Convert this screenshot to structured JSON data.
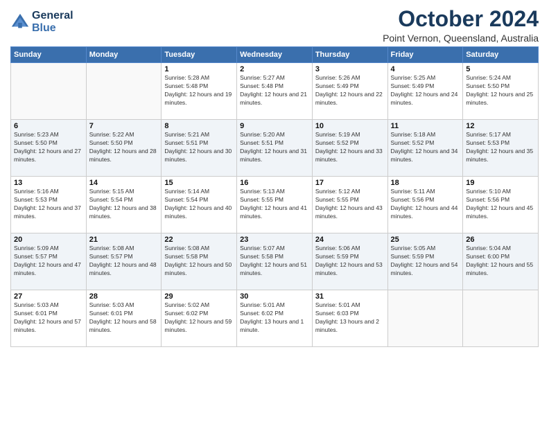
{
  "logo": {
    "line1": "General",
    "line2": "Blue"
  },
  "title": "October 2024",
  "subtitle": "Point Vernon, Queensland, Australia",
  "weekdays": [
    "Sunday",
    "Monday",
    "Tuesday",
    "Wednesday",
    "Thursday",
    "Friday",
    "Saturday"
  ],
  "weeks": [
    [
      {
        "day": "",
        "sunrise": "",
        "sunset": "",
        "daylight": ""
      },
      {
        "day": "",
        "sunrise": "",
        "sunset": "",
        "daylight": ""
      },
      {
        "day": "1",
        "sunrise": "Sunrise: 5:28 AM",
        "sunset": "Sunset: 5:48 PM",
        "daylight": "Daylight: 12 hours and 19 minutes."
      },
      {
        "day": "2",
        "sunrise": "Sunrise: 5:27 AM",
        "sunset": "Sunset: 5:48 PM",
        "daylight": "Daylight: 12 hours and 21 minutes."
      },
      {
        "day": "3",
        "sunrise": "Sunrise: 5:26 AM",
        "sunset": "Sunset: 5:49 PM",
        "daylight": "Daylight: 12 hours and 22 minutes."
      },
      {
        "day": "4",
        "sunrise": "Sunrise: 5:25 AM",
        "sunset": "Sunset: 5:49 PM",
        "daylight": "Daylight: 12 hours and 24 minutes."
      },
      {
        "day": "5",
        "sunrise": "Sunrise: 5:24 AM",
        "sunset": "Sunset: 5:50 PM",
        "daylight": "Daylight: 12 hours and 25 minutes."
      }
    ],
    [
      {
        "day": "6",
        "sunrise": "Sunrise: 5:23 AM",
        "sunset": "Sunset: 5:50 PM",
        "daylight": "Daylight: 12 hours and 27 minutes."
      },
      {
        "day": "7",
        "sunrise": "Sunrise: 5:22 AM",
        "sunset": "Sunset: 5:50 PM",
        "daylight": "Daylight: 12 hours and 28 minutes."
      },
      {
        "day": "8",
        "sunrise": "Sunrise: 5:21 AM",
        "sunset": "Sunset: 5:51 PM",
        "daylight": "Daylight: 12 hours and 30 minutes."
      },
      {
        "day": "9",
        "sunrise": "Sunrise: 5:20 AM",
        "sunset": "Sunset: 5:51 PM",
        "daylight": "Daylight: 12 hours and 31 minutes."
      },
      {
        "day": "10",
        "sunrise": "Sunrise: 5:19 AM",
        "sunset": "Sunset: 5:52 PM",
        "daylight": "Daylight: 12 hours and 33 minutes."
      },
      {
        "day": "11",
        "sunrise": "Sunrise: 5:18 AM",
        "sunset": "Sunset: 5:52 PM",
        "daylight": "Daylight: 12 hours and 34 minutes."
      },
      {
        "day": "12",
        "sunrise": "Sunrise: 5:17 AM",
        "sunset": "Sunset: 5:53 PM",
        "daylight": "Daylight: 12 hours and 35 minutes."
      }
    ],
    [
      {
        "day": "13",
        "sunrise": "Sunrise: 5:16 AM",
        "sunset": "Sunset: 5:53 PM",
        "daylight": "Daylight: 12 hours and 37 minutes."
      },
      {
        "day": "14",
        "sunrise": "Sunrise: 5:15 AM",
        "sunset": "Sunset: 5:54 PM",
        "daylight": "Daylight: 12 hours and 38 minutes."
      },
      {
        "day": "15",
        "sunrise": "Sunrise: 5:14 AM",
        "sunset": "Sunset: 5:54 PM",
        "daylight": "Daylight: 12 hours and 40 minutes."
      },
      {
        "day": "16",
        "sunrise": "Sunrise: 5:13 AM",
        "sunset": "Sunset: 5:55 PM",
        "daylight": "Daylight: 12 hours and 41 minutes."
      },
      {
        "day": "17",
        "sunrise": "Sunrise: 5:12 AM",
        "sunset": "Sunset: 5:55 PM",
        "daylight": "Daylight: 12 hours and 43 minutes."
      },
      {
        "day": "18",
        "sunrise": "Sunrise: 5:11 AM",
        "sunset": "Sunset: 5:56 PM",
        "daylight": "Daylight: 12 hours and 44 minutes."
      },
      {
        "day": "19",
        "sunrise": "Sunrise: 5:10 AM",
        "sunset": "Sunset: 5:56 PM",
        "daylight": "Daylight: 12 hours and 45 minutes."
      }
    ],
    [
      {
        "day": "20",
        "sunrise": "Sunrise: 5:09 AM",
        "sunset": "Sunset: 5:57 PM",
        "daylight": "Daylight: 12 hours and 47 minutes."
      },
      {
        "day": "21",
        "sunrise": "Sunrise: 5:08 AM",
        "sunset": "Sunset: 5:57 PM",
        "daylight": "Daylight: 12 hours and 48 minutes."
      },
      {
        "day": "22",
        "sunrise": "Sunrise: 5:08 AM",
        "sunset": "Sunset: 5:58 PM",
        "daylight": "Daylight: 12 hours and 50 minutes."
      },
      {
        "day": "23",
        "sunrise": "Sunrise: 5:07 AM",
        "sunset": "Sunset: 5:58 PM",
        "daylight": "Daylight: 12 hours and 51 minutes."
      },
      {
        "day": "24",
        "sunrise": "Sunrise: 5:06 AM",
        "sunset": "Sunset: 5:59 PM",
        "daylight": "Daylight: 12 hours and 53 minutes."
      },
      {
        "day": "25",
        "sunrise": "Sunrise: 5:05 AM",
        "sunset": "Sunset: 5:59 PM",
        "daylight": "Daylight: 12 hours and 54 minutes."
      },
      {
        "day": "26",
        "sunrise": "Sunrise: 5:04 AM",
        "sunset": "Sunset: 6:00 PM",
        "daylight": "Daylight: 12 hours and 55 minutes."
      }
    ],
    [
      {
        "day": "27",
        "sunrise": "Sunrise: 5:03 AM",
        "sunset": "Sunset: 6:01 PM",
        "daylight": "Daylight: 12 hours and 57 minutes."
      },
      {
        "day": "28",
        "sunrise": "Sunrise: 5:03 AM",
        "sunset": "Sunset: 6:01 PM",
        "daylight": "Daylight: 12 hours and 58 minutes."
      },
      {
        "day": "29",
        "sunrise": "Sunrise: 5:02 AM",
        "sunset": "Sunset: 6:02 PM",
        "daylight": "Daylight: 12 hours and 59 minutes."
      },
      {
        "day": "30",
        "sunrise": "Sunrise: 5:01 AM",
        "sunset": "Sunset: 6:02 PM",
        "daylight": "Daylight: 13 hours and 1 minute."
      },
      {
        "day": "31",
        "sunrise": "Sunrise: 5:01 AM",
        "sunset": "Sunset: 6:03 PM",
        "daylight": "Daylight: 13 hours and 2 minutes."
      },
      {
        "day": "",
        "sunrise": "",
        "sunset": "",
        "daylight": ""
      },
      {
        "day": "",
        "sunrise": "",
        "sunset": "",
        "daylight": ""
      }
    ]
  ]
}
